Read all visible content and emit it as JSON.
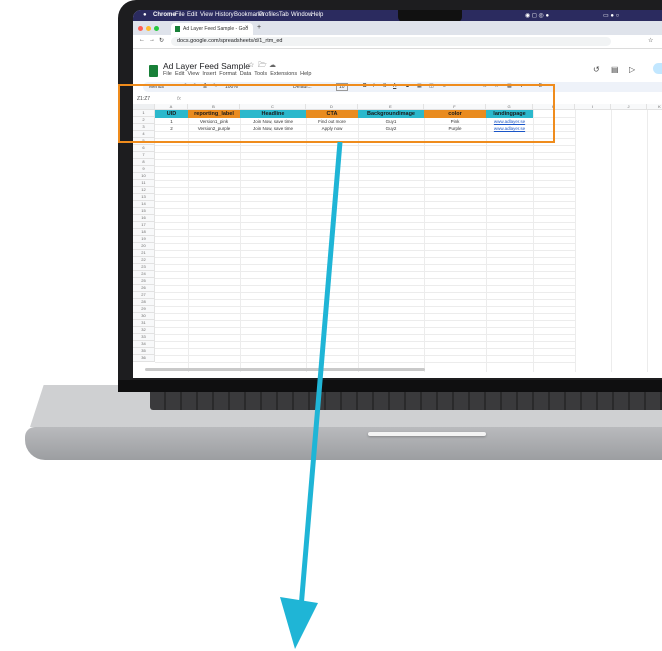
{
  "macos_menubar": {
    "apple": "",
    "items": [
      "Chrome",
      "File",
      "Edit",
      "View",
      "History",
      "Bookmarks",
      "Profiles",
      "Tab",
      "Window",
      "Help"
    ]
  },
  "browser": {
    "tab_title": "Ad Layer Feed Sample - Goo",
    "url": "docs.google.com/spreadsheets/d/1_rtm_ed"
  },
  "sheets": {
    "doc_title": "Ad Layer Feed Sample",
    "menu": [
      "File",
      "Edit",
      "View",
      "Insert",
      "Format",
      "Data",
      "Tools",
      "Extensions",
      "Help"
    ],
    "toolbar": {
      "menus": "Menus",
      "zoom": "100%",
      "font": "Defaul...",
      "font_size": "10"
    },
    "name_box": "Z1:Z7",
    "fx": "fx"
  },
  "column_letters": [
    "A",
    "B",
    "C",
    "D",
    "E",
    "F",
    "G",
    "H",
    "I",
    "J",
    "K"
  ],
  "row_numbers": [
    "1",
    "2",
    "3",
    "4",
    "5",
    "6",
    "7",
    "8",
    "9",
    "10",
    "11",
    "12",
    "13",
    "14",
    "15",
    "16",
    "17",
    "18",
    "19",
    "20",
    "21",
    "22",
    "23",
    "24",
    "25",
    "26",
    "27",
    "28",
    "29",
    "30",
    "31",
    "32",
    "33",
    "34",
    "35",
    "36"
  ],
  "table": {
    "headers": [
      "UID",
      "reporting_label",
      "Headline",
      "CTA",
      "Backgroundimage",
      "color",
      "landingpage"
    ],
    "header_colors": [
      "#2bb8cc",
      "#e98b1f",
      "#2bb8cc",
      "#e98b1f",
      "#2bb8cc",
      "#e98b1f",
      "#2bb8cc"
    ],
    "rows": [
      [
        "1",
        "Version1_pink",
        "Join Now, save time",
        "Find out more",
        "Guy1",
        "Pink",
        "www.adlayer.se"
      ],
      [
        "2",
        "Version2_purple",
        "Join Now, save time",
        "Apply now",
        "Guy2",
        "Purple",
        "www.adlayer.se"
      ]
    ]
  },
  "colors": {
    "highlight": "#ef8c1d",
    "arrow": "#1fb5d6"
  }
}
